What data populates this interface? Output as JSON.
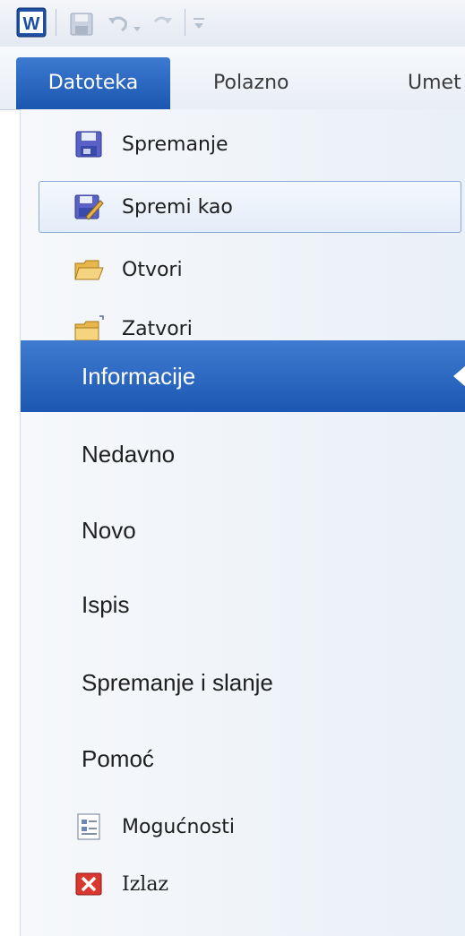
{
  "quick_access": {
    "app_icon": "word-icon",
    "save_icon": "save-icon",
    "undo_icon": "undo-icon",
    "redo_icon": "redo-icon",
    "customize_icon": "customize-qat-icon"
  },
  "tabs": {
    "file": "Datoteka",
    "home": "Polazno",
    "insert_partial": "Umet"
  },
  "commands": [
    {
      "label": "Spremanje",
      "icon": "save-icon"
    },
    {
      "label": "Spremi kao",
      "icon": "save-as-icon"
    },
    {
      "label": "Otvori",
      "icon": "open-folder-icon"
    },
    {
      "label": "Zatvori",
      "icon": "close-folder-icon"
    }
  ],
  "sections": [
    {
      "label": "Informacije",
      "active": true
    },
    {
      "label": "Nedavno"
    },
    {
      "label": "Novo"
    },
    {
      "label": "Ispis"
    },
    {
      "label": "Spremanje i slanje"
    },
    {
      "label": "Pomoć"
    }
  ],
  "bottom_commands": [
    {
      "label": "Mogućnosti",
      "icon": "options-icon"
    },
    {
      "label": "Izlaz",
      "icon": "exit-icon"
    }
  ],
  "colors": {
    "accent": "#1c58b3",
    "exit_red": "#d9372f"
  }
}
